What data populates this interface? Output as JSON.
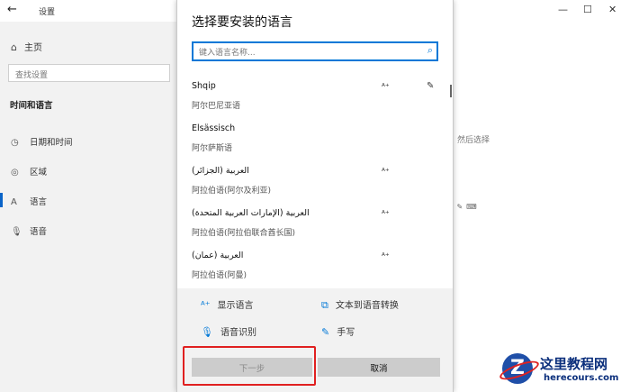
{
  "window": {
    "title": "设置",
    "back_icon": "arrow-left-icon",
    "controls": [
      "—",
      "☐",
      "✕"
    ]
  },
  "sidebar": {
    "home": "主页",
    "search_placeholder": "查找设置",
    "section": "时间和语言",
    "items": [
      {
        "label": "日期和时间",
        "icon": "clock-calendar-icon"
      },
      {
        "label": "区域",
        "icon": "globe-icon"
      },
      {
        "label": "语言",
        "icon": "language-icon",
        "selected": true
      },
      {
        "label": "语音",
        "icon": "microphone-icon"
      }
    ]
  },
  "right_panel": {
    "partial_text": "然后选择"
  },
  "dialog": {
    "title": "选择要安装的语言",
    "search_placeholder": "键入语言名称...",
    "languages": [
      {
        "name": "Shqip",
        "native": "阿尔巴尼亚语",
        "features": [
          "display-language-icon",
          "handwriting-icon"
        ]
      },
      {
        "name": "Elsässisch",
        "native": "阿尔萨斯语",
        "features": []
      },
      {
        "name": "العربية (الجزائر)",
        "native": "阿拉伯语(阿尔及利亚)",
        "features": [
          "display-language-icon"
        ]
      },
      {
        "name": "العربية (الإمارات العربية المتحدة)",
        "native": "阿拉伯语(阿拉伯联合酋长国)",
        "features": [
          "display-language-icon"
        ]
      },
      {
        "name": "العربية (عمان)",
        "native": "阿拉伯语(阿曼)",
        "features": [
          "display-language-icon"
        ]
      }
    ],
    "legend": {
      "display_language": "显示语言",
      "text_to_speech": "文本到语音转换",
      "speech_recognition": "语音识别",
      "handwriting": "手写"
    },
    "buttons": {
      "next": "下一步",
      "cancel": "取消"
    }
  },
  "colors": {
    "accent": "#0078d7",
    "highlight": "#e02020"
  },
  "watermark": {
    "title": "这里教程网",
    "url": "herecours.com"
  }
}
